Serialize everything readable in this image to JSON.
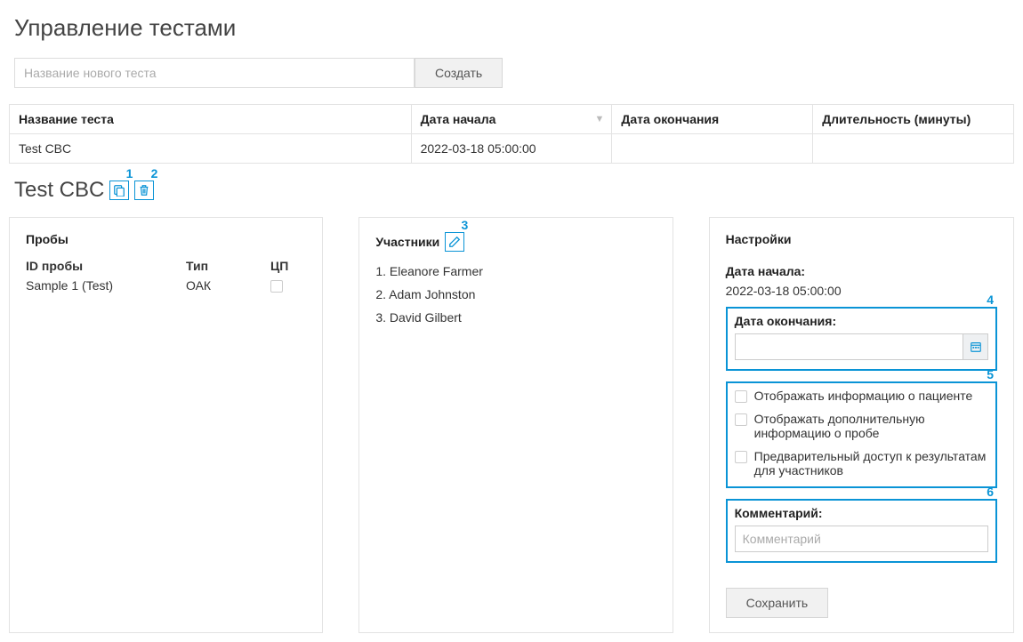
{
  "page_title": "Управление тестами",
  "create": {
    "placeholder": "Название нового теста",
    "button": "Создать"
  },
  "table": {
    "headers": {
      "name": "Название теста",
      "start": "Дата начала",
      "end": "Дата окончания",
      "duration": "Длительность (минуты)"
    },
    "rows": [
      {
        "name": "Test CBC",
        "start": "2022-03-18 05:00:00",
        "end": "",
        "duration": ""
      }
    ]
  },
  "selected_test": "Test CBC",
  "annotations": {
    "copy": "1",
    "delete": "2",
    "edit_participants": "3",
    "end_date_box": "4",
    "options_box": "5",
    "comment_box": "6"
  },
  "samples": {
    "title": "Пробы",
    "headers": {
      "id": "ID пробы",
      "type": "Тип",
      "cp": "ЦП"
    },
    "items": [
      {
        "id": "Sample 1 (Test)",
        "type": "ОАК",
        "cp": false
      }
    ]
  },
  "participants": {
    "title": "Участники",
    "items": [
      "1. Eleanore Farmer",
      "2. Adam Johnston",
      "3. David Gilbert"
    ]
  },
  "settings": {
    "title": "Настройки",
    "start_label": "Дата начала:",
    "start_value": "2022-03-18 05:00:00",
    "end_label": "Дата окончания:",
    "end_value": "",
    "options": [
      {
        "label": "Отображать информацию о пациенте",
        "checked": false
      },
      {
        "label": "Отображать дополнительную информацию о пробе",
        "checked": false
      },
      {
        "label": "Предварительный доступ к результатам для участников",
        "checked": false
      }
    ],
    "comment_label": "Комментарий:",
    "comment_placeholder": "Комментарий",
    "save": "Сохранить"
  }
}
